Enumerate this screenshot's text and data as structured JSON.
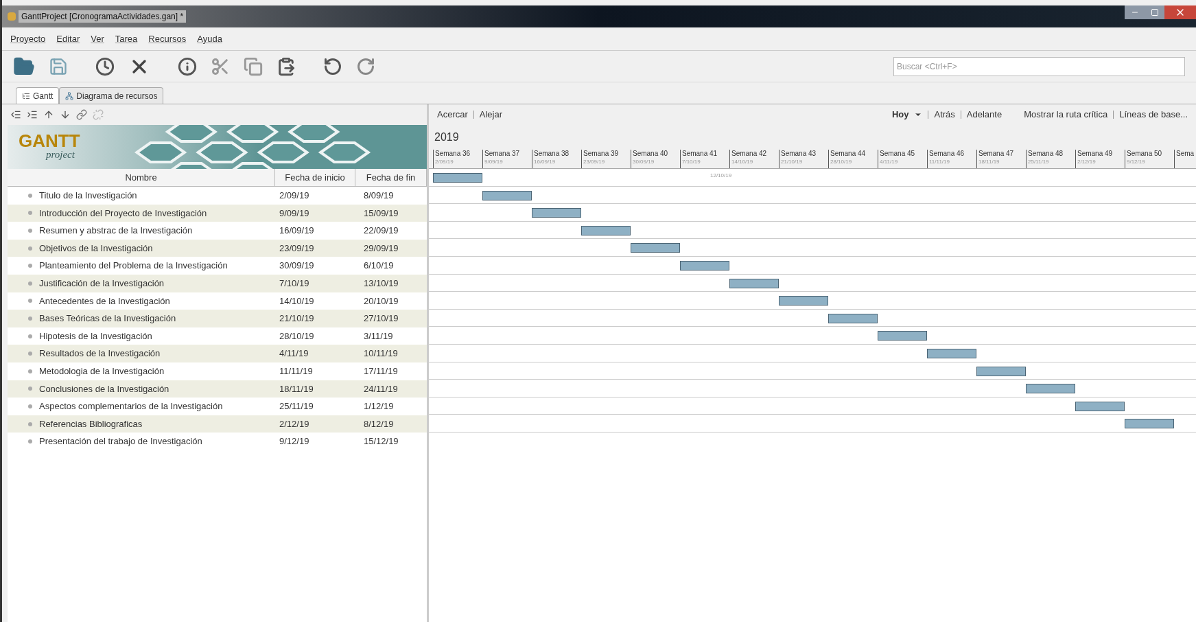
{
  "window": {
    "title": "GanttProject [CronogramaActividades.gan] *"
  },
  "menu": [
    "Proyecto",
    "Editar",
    "Ver",
    "Tarea",
    "Recursos",
    "Ayuda"
  ],
  "search": {
    "placeholder": "Buscar <Ctrl+F>"
  },
  "tabs": [
    {
      "label": "Gantt",
      "selected": true
    },
    {
      "label": "Diagrama de recursos",
      "selected": false
    }
  ],
  "logo": {
    "word": "GANTT",
    "sub": "project"
  },
  "table": {
    "columns": [
      "Nombre",
      "Fecha de inicio",
      "Fecha de fin"
    ],
    "rows": [
      {
        "name": "Titulo de la Investigación",
        "start": "2/09/19",
        "end": "8/09/19"
      },
      {
        "name": "Introducción del Proyecto de Investigación",
        "start": "9/09/19",
        "end": "15/09/19"
      },
      {
        "name": "Resumen y abstrac de la Investigación",
        "start": "16/09/19",
        "end": "22/09/19"
      },
      {
        "name": "Objetivos de la Investigación",
        "start": "23/09/19",
        "end": "29/09/19"
      },
      {
        "name": "Planteamiento del Problema de la Investigación",
        "start": "30/09/19",
        "end": "6/10/19"
      },
      {
        "name": "Justificación de la Investigación",
        "start": "7/10/19",
        "end": "13/10/19"
      },
      {
        "name": "Antecedentes de la Investigación",
        "start": "14/10/19",
        "end": "20/10/19"
      },
      {
        "name": "Bases Teóricas de la Investigación",
        "start": "21/10/19",
        "end": "27/10/19"
      },
      {
        "name": "Hipotesis de la Investigación",
        "start": "28/10/19",
        "end": "3/11/19"
      },
      {
        "name": "Resultados de la Investigación",
        "start": "4/11/19",
        "end": "10/11/19"
      },
      {
        "name": "Metodologia de la Investigación",
        "start": "11/11/19",
        "end": "17/11/19"
      },
      {
        "name": "Conclusiones de la Investigación",
        "start": "18/11/19",
        "end": "24/11/19"
      },
      {
        "name": "Aspectos complementarios de la Investigación",
        "start": "25/11/19",
        "end": "1/12/19"
      },
      {
        "name": "Referencias Bibliograficas",
        "start": "2/12/19",
        "end": "8/12/19"
      },
      {
        "name": "Presentación del trabajo de Investigación",
        "start": "9/12/19",
        "end": "15/12/19"
      }
    ]
  },
  "timeline": {
    "zoom_links": [
      "Acercar",
      "Alejar"
    ],
    "today": "Hoy",
    "nav_links": [
      "Atrás",
      "Adelante"
    ],
    "extra_links": [
      "Mostrar la ruta crítica",
      "Líneas de base..."
    ],
    "year": "2019",
    "today_marker": "12/10/19",
    "weeks": [
      {
        "label": "Semana 36",
        "date": "2/09/19"
      },
      {
        "label": "Semana 37",
        "date": "9/09/19"
      },
      {
        "label": "Semana 38",
        "date": "16/09/19"
      },
      {
        "label": "Semana 39",
        "date": "23/09/19"
      },
      {
        "label": "Semana 40",
        "date": "30/09/19"
      },
      {
        "label": "Semana 41",
        "date": "7/10/19"
      },
      {
        "label": "Semana 42",
        "date": "14/10/19"
      },
      {
        "label": "Semana 43",
        "date": "21/10/19"
      },
      {
        "label": "Semana 44",
        "date": "28/10/19"
      },
      {
        "label": "Semana 45",
        "date": "4/11/19"
      },
      {
        "label": "Semana 46",
        "date": "11/11/19"
      },
      {
        "label": "Semana 47",
        "date": "18/11/19"
      },
      {
        "label": "Semana 48",
        "date": "25/11/19"
      },
      {
        "label": "Semana 49",
        "date": "2/12/19"
      },
      {
        "label": "Semana 50",
        "date": "9/12/19"
      },
      {
        "label": "Sema"
      }
    ]
  }
}
